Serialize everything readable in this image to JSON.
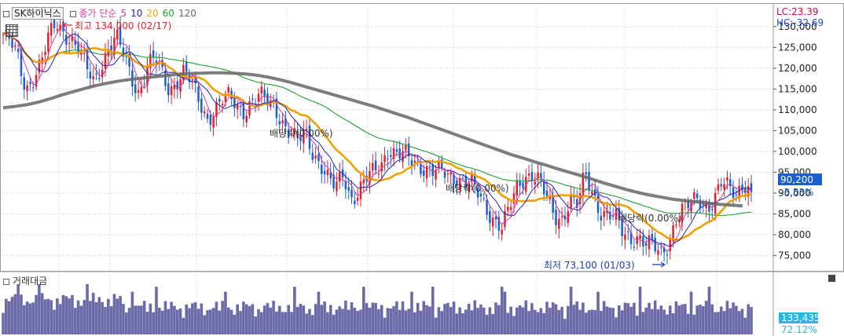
{
  "legend": {
    "stock_name": "SK하이닉스",
    "label": "종가 단순",
    "ma_periods": [
      "5",
      "10",
      "20",
      "60",
      "120"
    ],
    "ma_colors": [
      "#d23aa0",
      "#2020c0",
      "#f0a000",
      "#1fa030",
      "#666666"
    ]
  },
  "header_right": {
    "lc": "LC:23.39",
    "hc": "HC:-32.69"
  },
  "annotations": {
    "high": "최고 134,000 (02/17)",
    "low": "최저 73,100 (01/03)",
    "dividend_1": "배당락(0.00%)",
    "dividend_2": "배당락(0.00%)",
    "dividend_3": "배당락(0.00%)"
  },
  "current_price": {
    "value": "90,200",
    "change": "-3.53%"
  },
  "volume": {
    "title": "거래대금",
    "value": "133,435",
    "change": "72.12%"
  },
  "colors": {
    "up": "#e0202a",
    "down": "#1a5fd0",
    "volume": "#6b6aa8",
    "grid": "#d8d8d8"
  },
  "chart_data": {
    "type": "candlestick",
    "y_ticks": [
      75000,
      80000,
      85000,
      90000,
      95000,
      100000,
      105000,
      110000,
      115000,
      120000,
      125000,
      130000
    ],
    "ylim": [
      71500,
      134500
    ],
    "close_series": [
      128000,
      126000,
      122000,
      115000,
      118000,
      121000,
      127000,
      131000,
      129000,
      127000,
      124000,
      120000,
      117000,
      121000,
      125000,
      127000,
      123000,
      118000,
      114000,
      120000,
      122000,
      119000,
      115000,
      117000,
      119000,
      116000,
      112000,
      108000,
      110000,
      112000,
      113000,
      111000,
      110000,
      112000,
      113000,
      112000,
      111000,
      107000,
      104000,
      102000,
      105000,
      100000,
      97000,
      93000,
      91000,
      95000,
      89000,
      90000,
      93000,
      95000,
      97000,
      101000,
      99000,
      99000,
      98000,
      97000,
      96000,
      95000,
      95000,
      94000,
      94000,
      93000,
      92000,
      89000,
      86000,
      84000,
      82000,
      86000,
      91000,
      94000,
      95000,
      93000,
      88000,
      84000,
      84000,
      89000,
      87000,
      94000,
      90000,
      86000,
      85000,
      84000,
      80000,
      79000,
      80000,
      78000,
      77000,
      75000,
      78000,
      84000,
      86000,
      87000,
      89000,
      87000,
      88000,
      92000,
      91000,
      90000,
      93000,
      90200
    ],
    "ma_120": [
      110500,
      110800,
      111200,
      111800,
      112600,
      113500,
      114300,
      115100,
      115800,
      116400,
      116900,
      117300,
      117600,
      117900,
      118200,
      118500,
      118700,
      118800,
      118900,
      118900,
      118800,
      118600,
      118300,
      117800,
      117200,
      116500,
      115700,
      114900,
      114100,
      113300,
      112500,
      111700,
      110900,
      110000,
      109100,
      108200,
      107200,
      106200,
      105200,
      104200,
      103200,
      102200,
      101200,
      100200,
      99200,
      98400,
      97500,
      96700,
      95800,
      95000,
      94200,
      93300,
      92400,
      91600,
      90800,
      90100,
      89500,
      89000,
      88500,
      88200,
      87900,
      87600,
      87300,
      87100,
      86900
    ],
    "high_label": "최고 134,000 (02/17)",
    "low_label": "최저 73,100 (01/03)",
    "last_close": 90200,
    "last_change_pct": -3.53,
    "ma_periods": [
      5,
      10,
      20,
      60,
      120
    ]
  }
}
